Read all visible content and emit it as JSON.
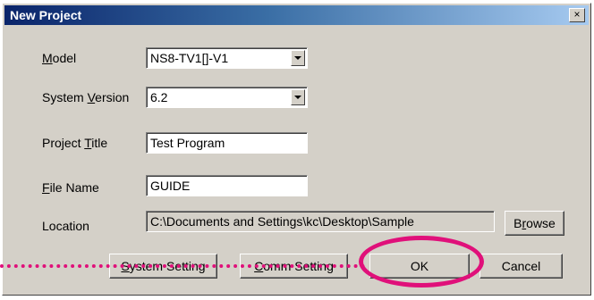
{
  "dialog": {
    "title": "New Project",
    "close_glyph": "×"
  },
  "fields": {
    "model": {
      "label_mnemonic": "M",
      "label_rest": "odel",
      "value": "NS8-TV1[]-V1"
    },
    "system_version": {
      "label_pre": "System ",
      "label_mnemonic": "V",
      "label_rest": "ersion",
      "value": "6.2"
    },
    "project_title": {
      "label_pre": "Project ",
      "label_mnemonic": "T",
      "label_rest": "itle",
      "value": "Test Program"
    },
    "file_name": {
      "label_mnemonic": "F",
      "label_rest": "ile Name",
      "value": "GUIDE"
    },
    "location": {
      "label": "Location",
      "value": "C:\\Documents and Settings\\kc\\Desktop\\Sample"
    }
  },
  "buttons": {
    "browse": {
      "label_pre": "B",
      "label_mnemonic": "r",
      "label_rest": "owse"
    },
    "system_setting": {
      "label_mnemonic": "S",
      "label_rest": "ystem Setting"
    },
    "comm_setting": {
      "label_mnemonic": "C",
      "label_rest": "omm Setting"
    },
    "ok": {
      "label": "OK"
    },
    "cancel": {
      "label": "Cancel"
    }
  },
  "annotation": {
    "color": "#e0107a"
  }
}
